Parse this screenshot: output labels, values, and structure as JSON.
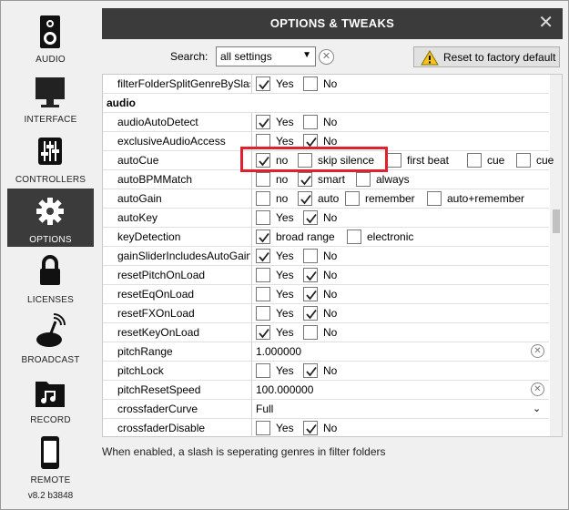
{
  "sidebar": {
    "items": [
      {
        "id": "audio",
        "label": "AUDIO"
      },
      {
        "id": "interface",
        "label": "INTERFACE"
      },
      {
        "id": "controllers",
        "label": "CONTROLLERS"
      },
      {
        "id": "options",
        "label": "OPTIONS"
      },
      {
        "id": "licenses",
        "label": "LICENSES"
      },
      {
        "id": "broadcast",
        "label": "BROADCAST"
      },
      {
        "id": "record",
        "label": "RECORD"
      },
      {
        "id": "remote",
        "label": "REMOTE"
      }
    ],
    "version": "v8.2 b3848"
  },
  "header": {
    "title": "OPTIONS & TWEAKS",
    "close_glyph": "✕"
  },
  "search": {
    "label": "Search:",
    "value": "all settings"
  },
  "reset_button": {
    "label": "Reset to factory default"
  },
  "rows": [
    {
      "name": "filterFolderSplitGenreBySlash",
      "type": "yesno",
      "yes": true,
      "no": false
    },
    {
      "name": "audio",
      "type": "section"
    },
    {
      "name": "audioAutoDetect",
      "type": "yesno",
      "yes": true,
      "no": false
    },
    {
      "name": "exclusiveAudioAccess",
      "type": "yesno",
      "yes": false,
      "no": true
    },
    {
      "name": "autoCue",
      "type": "options",
      "options": [
        {
          "label": "no",
          "checked": true
        },
        {
          "label": "skip silence",
          "checked": false
        },
        {
          "label": "first beat",
          "checked": false
        },
        {
          "label": "cue",
          "checked": false
        },
        {
          "label": "cue",
          "checked": false
        }
      ]
    },
    {
      "name": "autoBPMMatch",
      "type": "options",
      "options": [
        {
          "label": "no",
          "checked": false
        },
        {
          "label": "smart",
          "checked": true
        },
        {
          "label": "always",
          "checked": false
        }
      ]
    },
    {
      "name": "autoGain",
      "type": "options",
      "options": [
        {
          "label": "no",
          "checked": false
        },
        {
          "label": "auto",
          "checked": true
        },
        {
          "label": "remember",
          "checked": false
        },
        {
          "label": "auto+remember",
          "checked": false
        }
      ]
    },
    {
      "name": "autoKey",
      "type": "yesno",
      "yes": false,
      "no": true
    },
    {
      "name": "keyDetection",
      "type": "options",
      "options": [
        {
          "label": "broad range",
          "checked": true
        },
        {
          "label": "electronic",
          "checked": false
        }
      ]
    },
    {
      "name": "gainSliderIncludesAutoGain",
      "type": "yesno",
      "yes": true,
      "no": false
    },
    {
      "name": "resetPitchOnLoad",
      "type": "yesno",
      "yes": false,
      "no": true
    },
    {
      "name": "resetEqOnLoad",
      "type": "yesno",
      "yes": false,
      "no": true
    },
    {
      "name": "resetFXOnLoad",
      "type": "yesno",
      "yes": false,
      "no": true
    },
    {
      "name": "resetKeyOnLoad",
      "type": "yesno",
      "yes": true,
      "no": false
    },
    {
      "name": "pitchRange",
      "type": "text",
      "value": "1.000000"
    },
    {
      "name": "pitchLock",
      "type": "yesno",
      "yes": false,
      "no": true
    },
    {
      "name": "pitchResetSpeed",
      "type": "text",
      "value": "100.000000"
    },
    {
      "name": "crossfaderCurve",
      "type": "dropdown",
      "value": "Full"
    },
    {
      "name": "crossfaderDisable",
      "type": "yesno",
      "yes": false,
      "no": true
    }
  ],
  "yes_label": "Yes",
  "no_label": "No",
  "description": "When enabled, a slash is seperating genres in filter folders",
  "colors": {
    "title_bar": "#3b3b3b",
    "highlight": "#e0212d",
    "active_nav": "#3b3b3b"
  }
}
